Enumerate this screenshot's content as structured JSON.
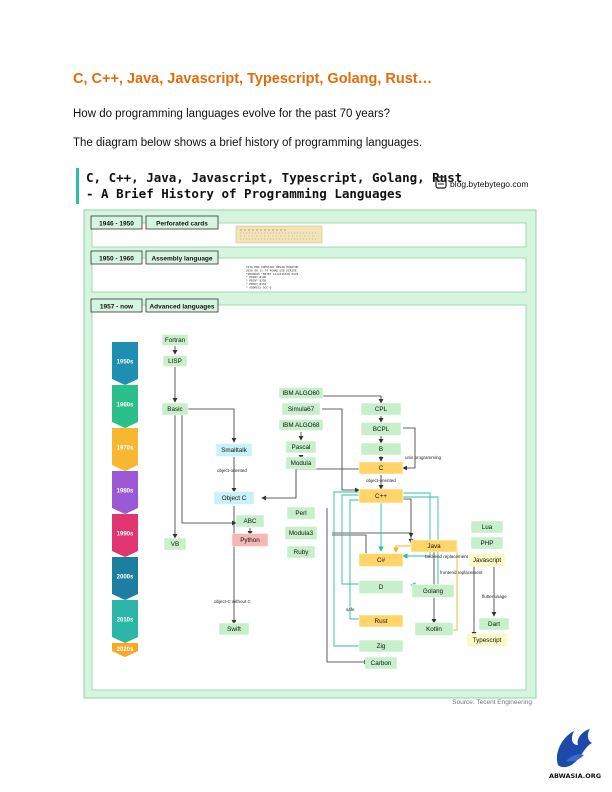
{
  "document": {
    "title": "C, C++, Java, Javascript, Typescript, Golang, Rust…",
    "paragraphs": [
      "How do programming languages evolve for the past 70 years?",
      "The diagram below shows a brief history of programming languages."
    ]
  },
  "figure": {
    "title_line1": "C, C++, Java, Javascript, Typescript, Golang, Rust",
    "title_line2": "- A Brief History of Programming Languages",
    "brand": "blog.bytebytego.com",
    "source": "Source: Tecent  Engineering",
    "eras": [
      {
        "years": "1946 - 1950",
        "label": "Perforated cards"
      },
      {
        "years": "1950 - 1960",
        "label": "Assembly language"
      },
      {
        "years": "1957 - now",
        "label": "Advanced languages"
      }
    ],
    "assembly_sample": [
      "CSTA          EBD    PGMSTART BEGIN MONITOR",
      "2030 00 11 74  PGMAE  USE   DERIVE",
      "  *PROGRAM  *ENTRY  LS12345678 PG78",
      "  * PRINT   8196",
      "  * PRINT   8256",
      "  * ENTRY   8154",
      "  * ADDRESS 5CC 0"
    ],
    "decades": [
      "1950s",
      "1960s",
      "1970s",
      "1980s",
      "1990s",
      "2000s",
      "2010s",
      "2020s"
    ],
    "languages": {
      "fortran": "Fortran",
      "lisp": "LISP",
      "basic": "Basic",
      "smalltalk": "Smalltalk",
      "objc": "Object C",
      "abc": "ABC",
      "python": "Python",
      "vb": "VB",
      "swift": "Swift",
      "algo60": "IBM ALGO60",
      "simula67": "Simula67",
      "algo68": "IBM ALGO68",
      "pascal": "Pascal",
      "modula": "Modula",
      "perl": "Perl",
      "modula3": "Modula3",
      "ruby": "Ruby",
      "cpl": "CPL",
      "bcpl": "BCPL",
      "b": "B",
      "c": "C",
      "cpp": "C++",
      "java": "Java",
      "csharp": "C#",
      "d": "D",
      "golang": "Golang",
      "rust": "Rust",
      "zig": "Zig",
      "carbon": "Carbon",
      "kotlin": "Kotlin",
      "lua": "Lua",
      "php": "PHP",
      "javascript": "Javascript",
      "dart": "Dart",
      "typescript": "Typescript"
    },
    "annotations": {
      "object_oriented_objc": "object-oriented",
      "unix": "unix programming",
      "object_oriented_cpp": "object-oriented",
      "backend": "backend replacement",
      "frontend": "frontend replacement",
      "flutter": "flutter usage",
      "objc_without_c": "object-C without C",
      "safe": "safe"
    },
    "colors": {
      "panel_bg": "#d6f5de",
      "panel_border": "#8fd4a0",
      "node_green": "#c7efc9",
      "node_yellow": "#ffd56a",
      "node_cyan": "#c8f2f7",
      "node_pink": "#f5b6b6",
      "node_pale_yellow": "#fdf8c6",
      "accent_teal": "#2bbfa6",
      "accent_yellow": "#e8b81e"
    }
  },
  "logo": {
    "text": "ABWASIA.ORG"
  }
}
